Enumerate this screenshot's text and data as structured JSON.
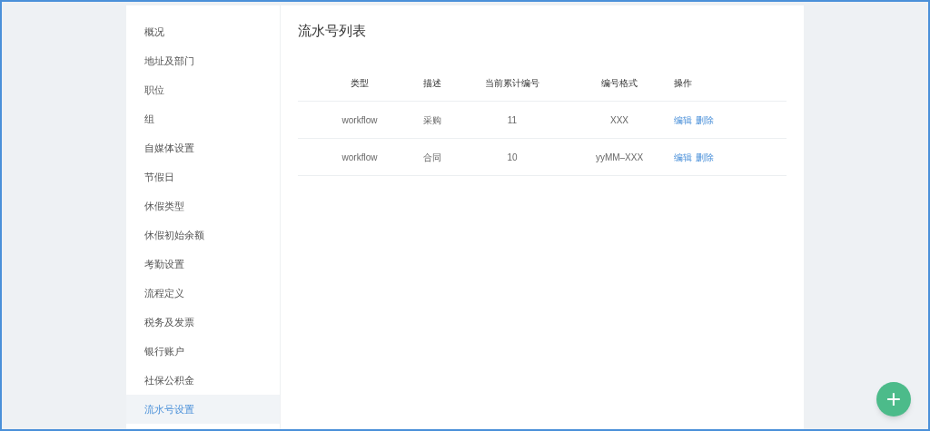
{
  "sidebar": {
    "items": [
      {
        "label": "概况",
        "selected": false
      },
      {
        "label": "地址及部门",
        "selected": false
      },
      {
        "label": "职位",
        "selected": false
      },
      {
        "label": "组",
        "selected": false
      },
      {
        "label": "自媒体设置",
        "selected": false
      },
      {
        "label": "节假日",
        "selected": false
      },
      {
        "label": "休假类型",
        "selected": false
      },
      {
        "label": "休假初始余额",
        "selected": false
      },
      {
        "label": "考勤设置",
        "selected": false
      },
      {
        "label": "流程定义",
        "selected": false
      },
      {
        "label": "税务及发票",
        "selected": false
      },
      {
        "label": "银行账户",
        "selected": false
      },
      {
        "label": "社保公积金",
        "selected": false
      },
      {
        "label": "流水号设置",
        "selected": true
      }
    ]
  },
  "page_title": "流水号列表",
  "table": {
    "columns": [
      "类型",
      "描述",
      "当前累计编号",
      "编号格式",
      "操作"
    ],
    "rows": [
      {
        "cells": [
          "workflow",
          "采购",
          "11",
          "XXX"
        ],
        "actions": [
          "编辑",
          "删除"
        ]
      },
      {
        "cells": [
          "workflow",
          "合同",
          "10",
          "yyMM–XXX"
        ],
        "actions": [
          "编辑",
          "删除"
        ]
      }
    ]
  },
  "fab": "+"
}
